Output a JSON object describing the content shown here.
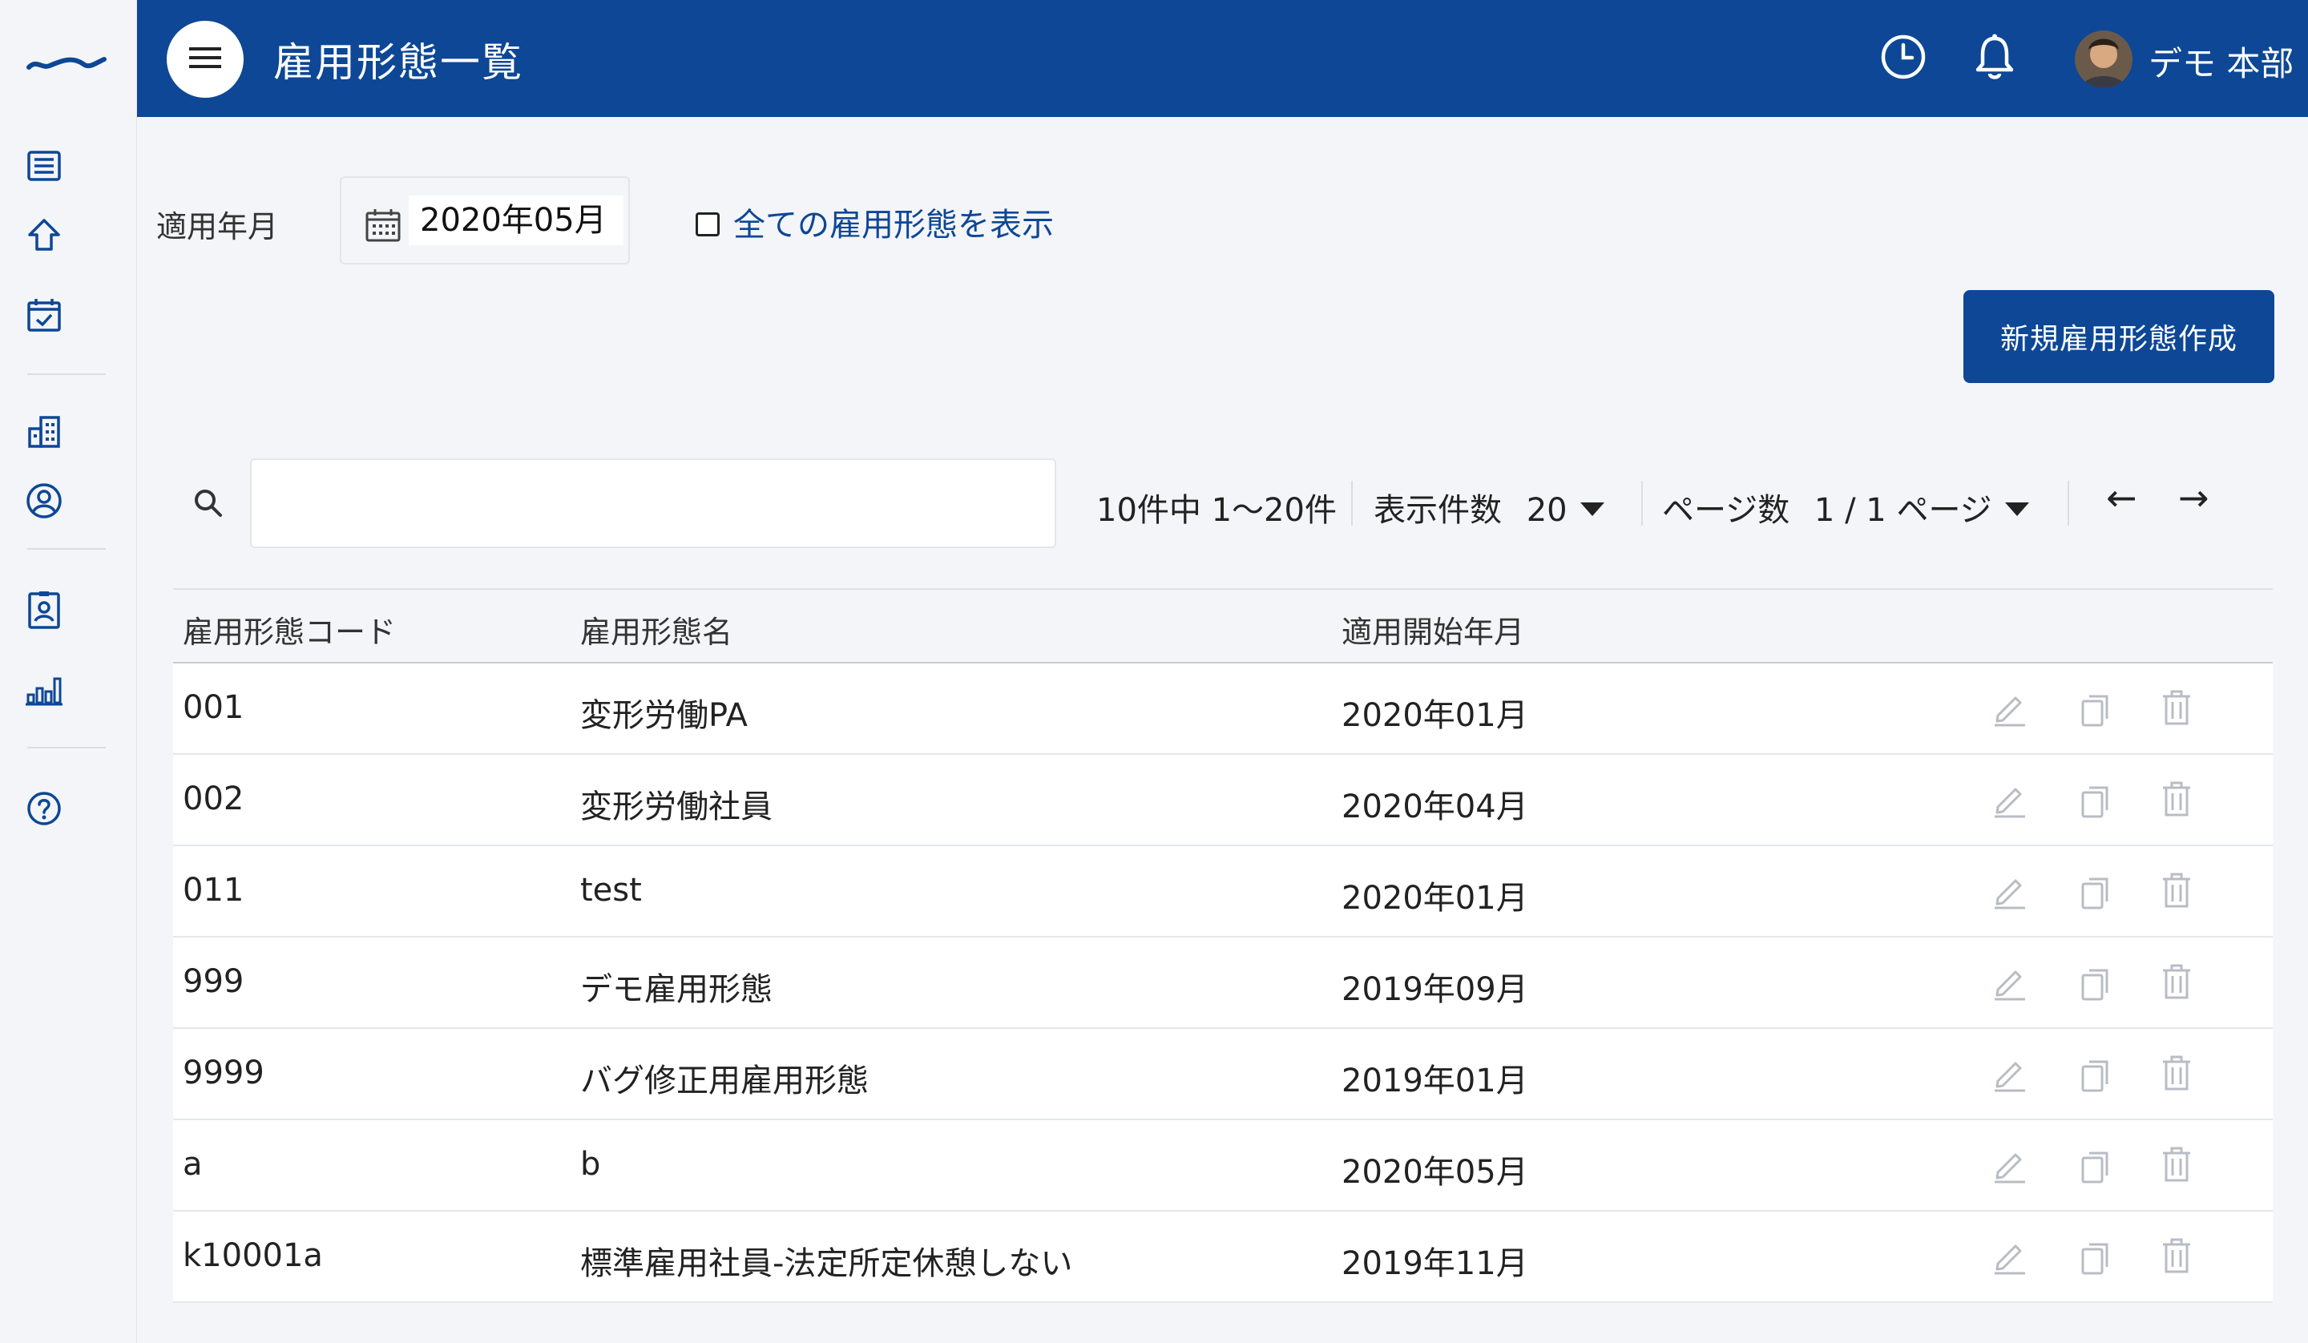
{
  "header": {
    "title": "雇用形態一覧",
    "user_name": "デモ 本部",
    "icons": [
      "menu-icon",
      "clock-icon",
      "bell-icon"
    ]
  },
  "sidebar": {
    "items": [
      {
        "icon": "list-icon"
      },
      {
        "icon": "home-icon"
      },
      {
        "icon": "calendar-check-icon"
      },
      {
        "icon": "building-icon"
      },
      {
        "icon": "user-circle-icon"
      },
      {
        "icon": "id-card-icon"
      },
      {
        "icon": "bar-chart-icon"
      },
      {
        "icon": "help-icon"
      }
    ]
  },
  "filters": {
    "date_label": "適用年月",
    "date_value": "2020年05月",
    "show_all_label": "全ての雇用形態を表示",
    "show_all_checked": false
  },
  "actions": {
    "new_button": "新規雇用形態作成"
  },
  "search": {
    "placeholder": "",
    "value": ""
  },
  "pagination": {
    "range_text": "10件中 1〜20件",
    "per_page_label": "表示件数",
    "per_page_value": "20",
    "page_label": "ページ数",
    "page_value": "1 / 1 ページ",
    "prev": "←",
    "next": "→"
  },
  "table": {
    "columns": [
      "雇用形態コード",
      "雇用形態名",
      "適用開始年月"
    ],
    "rows": [
      [
        "001",
        "変形労働PA",
        "2020年01月"
      ],
      [
        "002",
        "変形労働社員",
        "2020年04月"
      ],
      [
        "011",
        "test",
        "2020年01月"
      ],
      [
        "999",
        "デモ雇用形態",
        "2019年09月"
      ],
      [
        "9999",
        "バグ修正用雇用形態",
        "2019年01月"
      ],
      [
        "a",
        "b",
        "2020年05月"
      ],
      [
        "k10001a",
        "標準雇用社員-法定所定休憩しない",
        "2019年11月"
      ]
    ]
  },
  "colors": {
    "brand": "#0d4796",
    "background": "#f4f5f8",
    "row_icon": "#b8bcc4"
  }
}
